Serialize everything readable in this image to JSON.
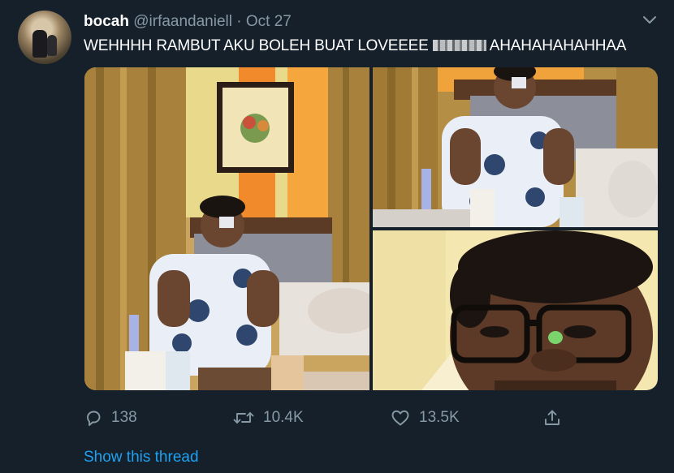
{
  "tweet": {
    "author_name": "bocah",
    "author_handle": "@irfaandaniell",
    "separator": "·",
    "date": "Oct 27",
    "text_before": "WEHHHH RAMBUT AKU BOLEH BUAT LOVEEEE",
    "text_after": "AHAHAHAHAHHAA"
  },
  "actions": {
    "replies": "138",
    "retweets": "10.4K",
    "likes": "13.5K"
  },
  "links": {
    "show_thread": "Show this thread"
  },
  "colors": {
    "background": "#15202b",
    "secondary_text": "#8899a6",
    "link": "#1da1f2"
  },
  "icons": [
    "chevron-down-icon",
    "reply-icon",
    "retweet-icon",
    "like-icon",
    "share-icon"
  ]
}
